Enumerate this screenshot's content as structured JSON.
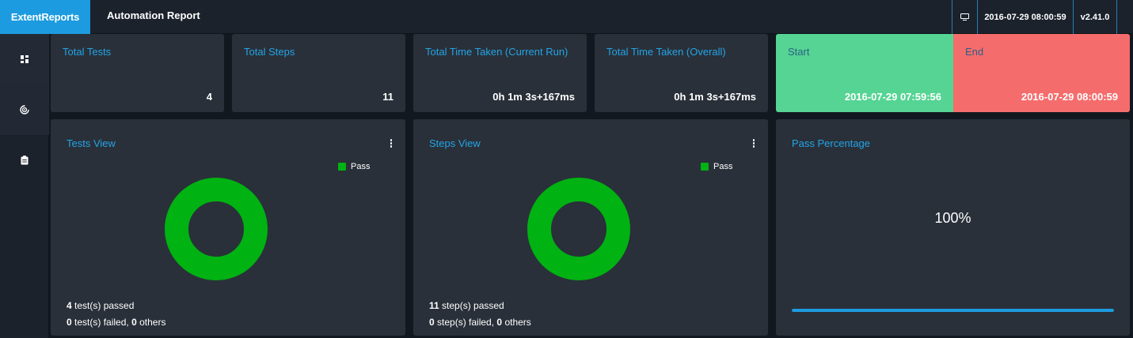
{
  "header": {
    "brand": "ExtentReports",
    "title": "Automation Report",
    "datetime": "2016-07-29 08:00:59",
    "version": "v2.41.0"
  },
  "sidebar": {
    "items": [
      {
        "icon": "dashboard-icon"
      },
      {
        "icon": "radar-icon"
      },
      {
        "icon": "clipboard-icon"
      }
    ]
  },
  "stats": {
    "total_tests": {
      "label": "Total Tests",
      "value": "4"
    },
    "total_steps": {
      "label": "Total Steps",
      "value": "11"
    },
    "time_current": {
      "label": "Total Time Taken (Current Run)",
      "value": "0h 1m 3s+167ms"
    },
    "time_overall": {
      "label": "Total Time Taken (Overall)",
      "value": "0h 1m 3s+167ms"
    },
    "start": {
      "label": "Start",
      "value": "2016-07-29 07:59:56"
    },
    "end": {
      "label": "End",
      "value": "2016-07-29 08:00:59"
    }
  },
  "tests_view": {
    "title": "Tests View",
    "legend": "Pass",
    "passed_count": "4",
    "passed_text": "test(s) passed",
    "failed_count": "0",
    "failed_text": "test(s) failed,",
    "others_count": "0",
    "others_text": "others"
  },
  "steps_view": {
    "title": "Steps View",
    "legend": "Pass",
    "passed_count": "11",
    "passed_text": "step(s) passed",
    "failed_count": "0",
    "failed_text": "step(s) failed,",
    "others_count": "0",
    "others_text": "others"
  },
  "pass_percentage": {
    "title": "Pass Percentage",
    "value": "100%",
    "fraction": 1.0
  },
  "colors": {
    "brand": "#1d9be0",
    "title_blue": "#24a4e6",
    "pass": "#00b212",
    "start": "#55d493",
    "end": "#f56c6c",
    "card": "#293039"
  }
}
